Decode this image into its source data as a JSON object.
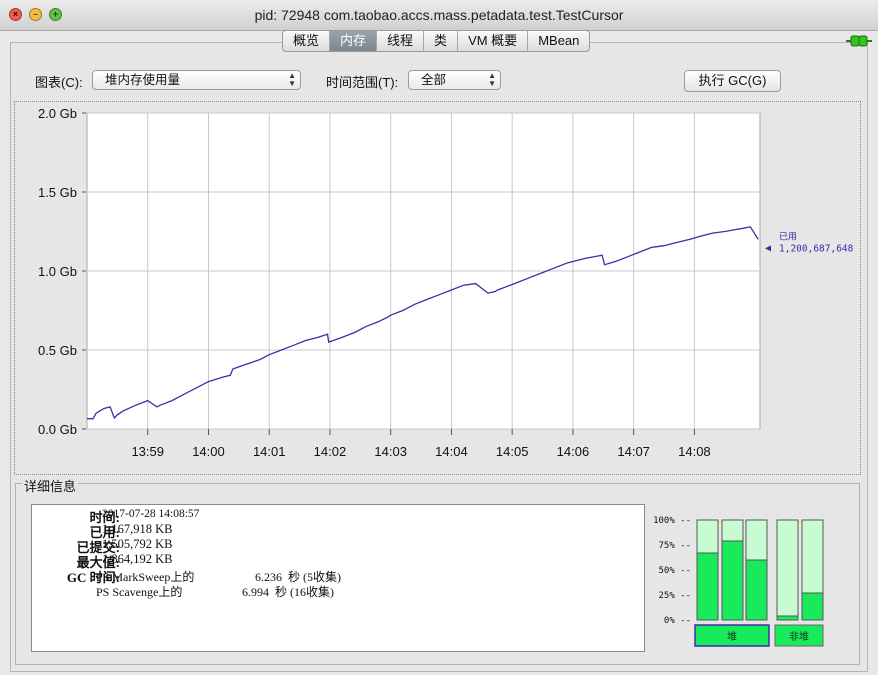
{
  "window": {
    "title": "pid: 72948 com.taobao.accs.mass.petadata.test.TestCursor"
  },
  "tabs": [
    {
      "label": "概览",
      "active": false
    },
    {
      "label": "内存",
      "active": true
    },
    {
      "label": "线程",
      "active": false
    },
    {
      "label": "类",
      "active": false
    },
    {
      "label": "VM 概要",
      "active": false
    },
    {
      "label": "MBean",
      "active": false
    }
  ],
  "controls": {
    "chart_label": "图表(C):",
    "chart_value": "堆内存使用量",
    "range_label": "时间范围(T):",
    "range_value": "全部",
    "gc_button": "执行 GC(G)"
  },
  "chart_data": {
    "type": "line",
    "title": "",
    "y_ticks": [
      "0.0 Gb",
      "0.5 Gb",
      "1.0 Gb",
      "1.5 Gb",
      "2.0 Gb"
    ],
    "y_range_gb": [
      0,
      2.0
    ],
    "x_ticks": [
      "13:59",
      "14:00",
      "14:01",
      "14:02",
      "14:03",
      "14:04",
      "14:05",
      "14:06",
      "14:07",
      "14:08"
    ],
    "x_range_min": [
      -1.0,
      10.08
    ],
    "grid": true,
    "line_color": "#3b2fa6",
    "legend": {
      "label": "已用",
      "value": "1,200,687,648"
    },
    "series": [
      {
        "name": "已用",
        "x_min": [
          -1.0,
          -0.9,
          -0.85,
          -0.72,
          -0.62,
          -0.55,
          -0.5,
          -0.4,
          -0.2,
          0.0,
          0.15,
          0.2,
          0.4,
          0.6,
          0.85,
          1.0,
          1.25,
          1.36,
          1.4,
          1.55,
          1.85,
          2.0,
          2.2,
          2.4,
          2.6,
          2.8,
          2.96,
          2.98,
          3.2,
          3.4,
          3.6,
          3.8,
          3.96,
          4.0,
          4.2,
          4.4,
          4.6,
          4.8,
          5.0,
          5.2,
          5.4,
          5.6,
          5.72,
          5.76,
          5.9,
          6.1,
          6.3,
          6.5,
          6.7,
          6.9,
          7.2,
          7.48,
          7.52,
          7.7,
          7.9,
          8.1,
          8.3,
          8.5,
          8.7,
          8.92,
          9.1,
          9.3,
          9.5,
          9.65,
          9.8,
          9.92,
          10.05
        ],
        "y_gb": [
          0.065,
          0.065,
          0.1,
          0.13,
          0.14,
          0.07,
          0.09,
          0.115,
          0.15,
          0.18,
          0.14,
          0.15,
          0.18,
          0.22,
          0.27,
          0.3,
          0.33,
          0.34,
          0.38,
          0.4,
          0.44,
          0.47,
          0.5,
          0.53,
          0.56,
          0.58,
          0.6,
          0.55,
          0.58,
          0.61,
          0.65,
          0.68,
          0.71,
          0.72,
          0.75,
          0.79,
          0.82,
          0.85,
          0.88,
          0.91,
          0.92,
          0.86,
          0.87,
          0.88,
          0.9,
          0.93,
          0.96,
          0.99,
          1.02,
          1.05,
          1.08,
          1.1,
          1.04,
          1.06,
          1.09,
          1.12,
          1.15,
          1.16,
          1.18,
          1.2,
          1.22,
          1.24,
          1.25,
          1.26,
          1.27,
          1.28,
          1.2
        ]
      }
    ]
  },
  "details": {
    "title": "详细信息",
    "rows": [
      {
        "key": "时间:",
        "value": "2017-07-28 14:08:57"
      },
      {
        "key": "已用:",
        "value": "1,167,918 KB"
      },
      {
        "key": "已提交:",
        "value": "1,505,792 KB"
      },
      {
        "key": "最大值:",
        "value": "1,864,192 KB"
      }
    ],
    "gc_key": "GC 时间:",
    "gc": [
      {
        "collector": "PS MarkSweep上的",
        "time": "6.236",
        "unit": "秒 (5收集)"
      },
      {
        "collector": "PS Scavenge上的",
        "time": "6.994",
        "unit": "秒 (16收集)"
      }
    ]
  },
  "pools": {
    "y_ticks": [
      "100% --",
      "75% --",
      "50% --",
      "25% --",
      "0% --"
    ],
    "heap_label": "堆",
    "nonheap_label": "非堆",
    "heap_used_fractions": [
      0.67,
      0.79,
      0.6
    ],
    "nonheap_used_fractions": [
      0.04,
      0.27
    ],
    "fill_color": "#19ea5c",
    "track_color": "#c6fbd3"
  }
}
